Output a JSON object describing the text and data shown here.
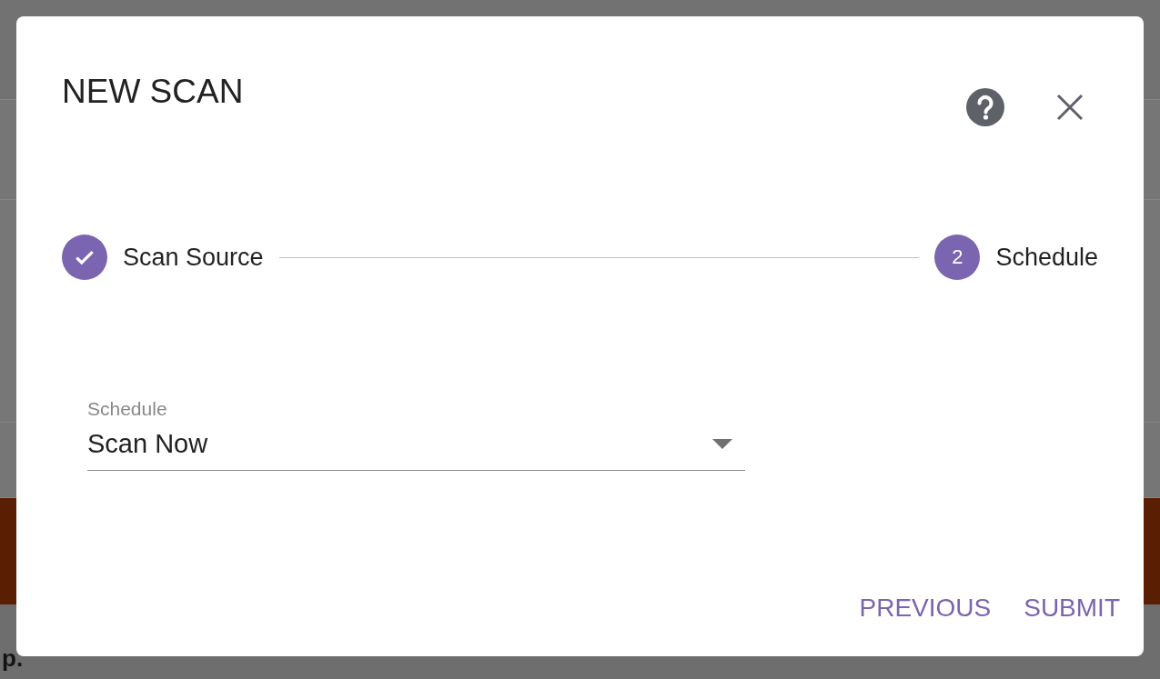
{
  "background_text": "p.",
  "dialog": {
    "title": "NEW SCAN",
    "steps": [
      {
        "label": "Scan Source",
        "completed": true
      },
      {
        "label": "Schedule",
        "number": "2",
        "completed": false
      }
    ],
    "field": {
      "label": "Schedule",
      "value": "Scan Now"
    },
    "buttons": [
      "PREVIOUS",
      "SUBMIT"
    ]
  }
}
